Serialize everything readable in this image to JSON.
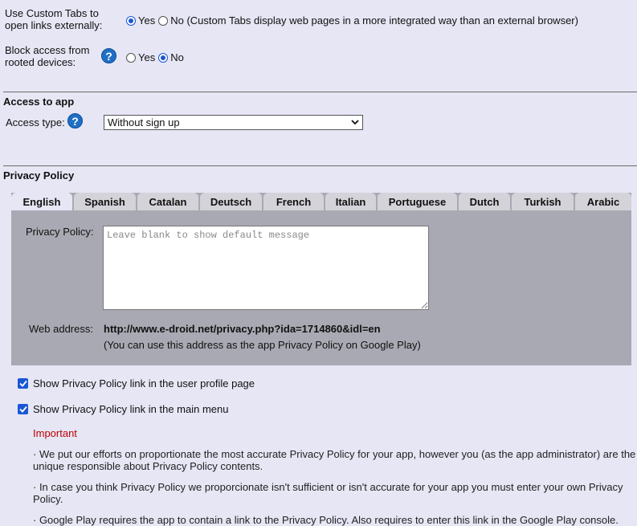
{
  "custom_tabs": {
    "label": "Use Custom Tabs to open links externally:",
    "yes": "Yes",
    "no": "No (Custom Tabs display web pages in a more integrated way than an external browser)",
    "selected": "Yes"
  },
  "rooted": {
    "label": "Block access from rooted devices:",
    "yes": "Yes",
    "no": "No",
    "selected": "No"
  },
  "access": {
    "section_title": "Access to app",
    "type_label": "Access type:",
    "type_value": "Without sign up"
  },
  "privacy": {
    "section_title": "Privacy Policy",
    "tabs": [
      "English",
      "Spanish",
      "Catalan",
      "Deutsch",
      "French",
      "Italian",
      "Portuguese",
      "Dutch",
      "Turkish",
      "Arabic"
    ],
    "active_tab": "English",
    "policy_label": "Privacy Policy:",
    "policy_placeholder": "Leave blank to show default message",
    "web_label": "Web address:",
    "web_url": "http://www.e-droid.net/privacy.php?ida=1714860&idl=en",
    "web_note": "(You can use this address as the app Privacy Policy on Google Play)",
    "check_profile": "Show Privacy Policy link in the user profile page",
    "check_menu": "Show Privacy Policy link in the main menu",
    "important": "Important",
    "note1": "· We put our efforts on proportionate the most accurate Privacy Policy for your app, however you (as the app administrator) are the unique responsible about Privacy Policy contents.",
    "note2": "· In case you think Privacy Policy we proporcionate isn't sufficient or isn't accurate for your app you must enter your own Privacy Policy.",
    "note3": "· Google Play requires the app to contain a link to the Privacy Policy. Also requires to enter this link in the Google Play console."
  },
  "colors": {
    "accent": "#1a57d4",
    "important": "#c00000",
    "panel": "#a9a9b3"
  }
}
